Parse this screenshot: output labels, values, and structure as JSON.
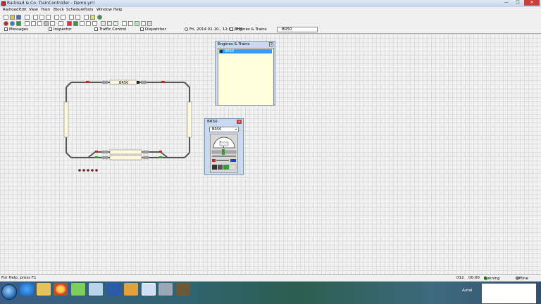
{
  "window": {
    "title": "Railroad & Co. TrainController - Demo.yrrl",
    "controls": {
      "minimize": "—",
      "maximize": "☐",
      "close": "✕"
    }
  },
  "menu": [
    "Railroad",
    "Edit",
    "View",
    "Train",
    "Block",
    "Schedule",
    "Tools",
    "Window",
    "Help"
  ],
  "tabs": {
    "items": [
      {
        "label": "Messages",
        "icon": "messages-icon"
      },
      {
        "label": "Inspector",
        "icon": "inspector-icon"
      },
      {
        "label": "Traffic Control",
        "icon": "traffic-control-icon"
      },
      {
        "label": "Dispatcher",
        "icon": "dispatcher-icon"
      },
      {
        "label": "Fri, 2014.01.10., 12:07, PM",
        "icon": "clock-icon"
      },
      {
        "label": "Engines & Trains",
        "icon": "engines-icon"
      }
    ],
    "active": "BR50"
  },
  "layout": {
    "train_label": "BR50",
    "colors": {
      "track": "#555555",
      "block": "#fff8dc",
      "signal_red": "#cc2222",
      "signal_green": "#22aa22",
      "marker": "#7a1f1f"
    }
  },
  "engines_window": {
    "title": "Engines & Trains",
    "close": "x",
    "items": [
      {
        "label": "BR50",
        "selected": true
      }
    ]
  },
  "throttle": {
    "title": "BR50",
    "close": "x",
    "selected": "BR50",
    "dropdown_arrow": "▾"
  },
  "status": {
    "help": "For Help, press F1",
    "code": "012",
    "time": "00:00",
    "running": "Running",
    "offline": "Offline",
    "colors": {
      "running": "#22aa22",
      "offline": "#999999"
    }
  },
  "taskbar": {
    "apps": [
      "ie-icon",
      "explorer-icon",
      "chrome-icon",
      "app-icon",
      "tools-icon",
      "word-icon",
      "outlook-icon",
      "editor-icon",
      "disk-icon",
      "photo-icon"
    ],
    "language": "Autal"
  }
}
